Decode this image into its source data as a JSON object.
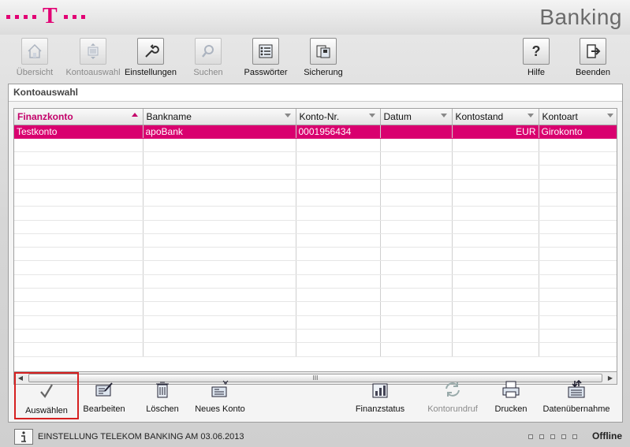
{
  "app": {
    "title": "Banking"
  },
  "toolbar": {
    "left": [
      {
        "label": "Übersicht",
        "icon": "house-icon",
        "disabled": true
      },
      {
        "label": "Kontoauswahl",
        "icon": "account-select-icon",
        "disabled": true
      },
      {
        "label": "Einstellungen",
        "icon": "wrench-icon",
        "disabled": false
      },
      {
        "label": "Suchen",
        "icon": "magnifier-icon",
        "disabled": true
      },
      {
        "label": "Passwörter",
        "icon": "password-list-icon",
        "disabled": false
      },
      {
        "label": "Sicherung",
        "icon": "backup-icon",
        "disabled": false
      }
    ],
    "right": [
      {
        "label": "Hilfe",
        "icon": "help-icon",
        "disabled": false
      },
      {
        "label": "Beenden",
        "icon": "exit-icon",
        "disabled": false
      }
    ]
  },
  "panel": {
    "title": "Kontoauswahl"
  },
  "table": {
    "columns": [
      "Finanzkonto",
      "Bankname",
      "Konto-Nr.",
      "Datum",
      "Kontostand",
      "Kontoart"
    ],
    "sorted_column": "Finanzkonto",
    "rows": [
      {
        "finanzkonto": "Testkonto",
        "bankname": "apoBank",
        "konto_nr": "0001956434",
        "datum": "",
        "kontostand": "EUR",
        "kontoart": "Girokonto",
        "selected": true
      }
    ],
    "scroll_thumb": "III"
  },
  "actions": {
    "auswaehlen": "Auswählen",
    "bearbeiten": "Bearbeiten",
    "loeschen": "Löschen",
    "neues_konto": "Neues Konto",
    "finanzstatus": "Finanzstatus",
    "kontorundruf": "Kontorundruf",
    "drucken": "Drucken",
    "datenuebernahme": "Datenübernahme"
  },
  "status": {
    "message": "EINSTELLUNG TELEKOM BANKING AM 03.06.2013",
    "connection": "Offline"
  },
  "colors": {
    "brand": "#e20074",
    "selection": "#d9006f",
    "highlight_border": "#d62020"
  }
}
